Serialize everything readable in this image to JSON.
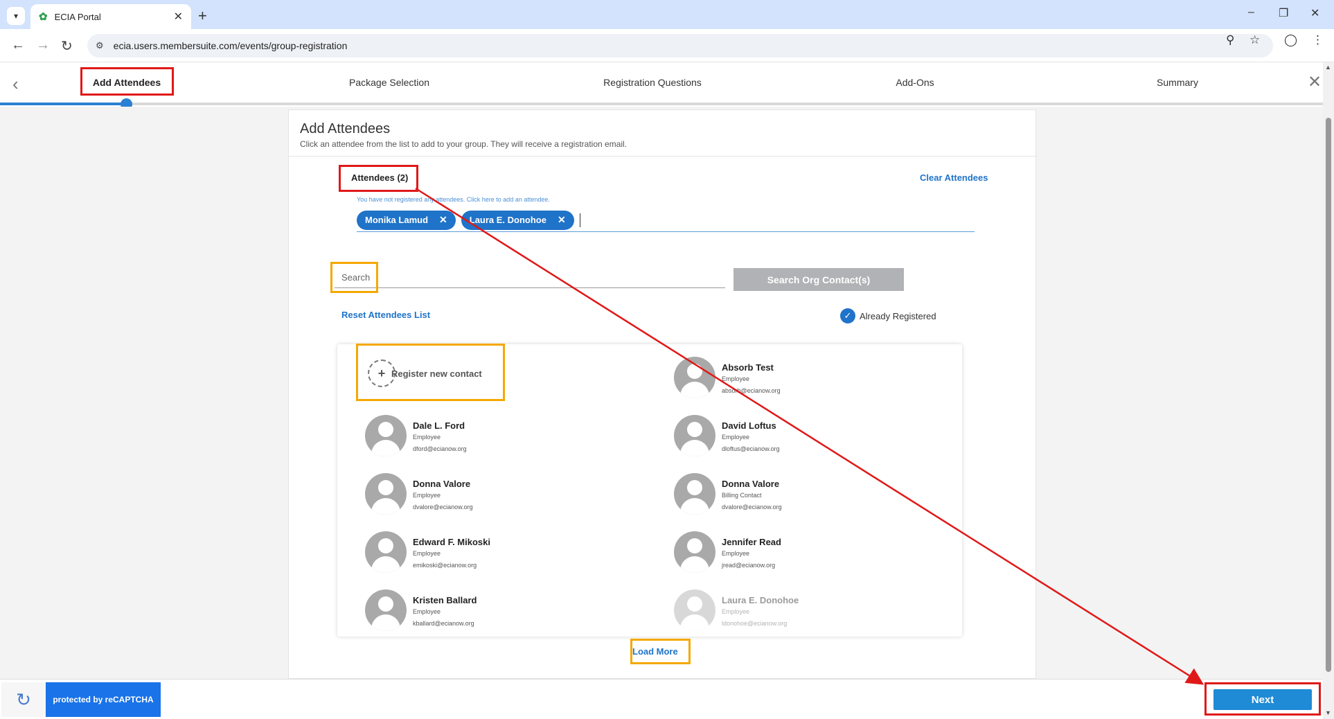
{
  "browser": {
    "tab_title": "ECIA Portal",
    "url": "ecia.users.membersuite.com/events/group-registration"
  },
  "wizard": {
    "steps": [
      "Add Attendees",
      "Package Selection",
      "Registration Questions",
      "Add-Ons",
      "Summary"
    ],
    "progress_fraction": 0.095
  },
  "page": {
    "title": "Add Attendees",
    "subtitle": "Click an attendee from the list to add to your group. They will receive a registration email.",
    "attendees_label": "Attendees (2)",
    "clear_link": "Clear Attendees",
    "hint": "You have not registered any attendees. Click here to add an attendee.",
    "selected": [
      "Monika Lamud",
      "Laura E. Donohoe"
    ],
    "search_placeholder": "Search",
    "search_button": "Search Org Contact(s)",
    "reset_link": "Reset Attendees List",
    "already_registered": "Already Registered",
    "register_new": "Register new contact",
    "contacts": [
      {
        "name": "Absorb Test",
        "role": "Employee",
        "email": "absorb@ecianow.org"
      },
      {
        "name": "Dale L. Ford",
        "role": "Employee",
        "email": "dford@ecianow.org"
      },
      {
        "name": "David Loftus",
        "role": "Employee",
        "email": "dloftus@ecianow.org"
      },
      {
        "name": "Donna Valore",
        "role": "Employee",
        "email": "dvalore@ecianow.org"
      },
      {
        "name": "Donna Valore",
        "role": "Billing Contact",
        "email": "dvalore@ecianow.org"
      },
      {
        "name": "Edward F. Mikoski",
        "role": "Employee",
        "email": "emikoski@ecianow.org"
      },
      {
        "name": "Jennifer Read",
        "role": "Employee",
        "email": "jread@ecianow.org"
      },
      {
        "name": "Kristen Ballard",
        "role": "Employee",
        "email": "kballard@ecianow.org"
      },
      {
        "name": "Laura E. Donohoe",
        "role": "Employee",
        "email": "ldonohoe@ecianow.org"
      }
    ],
    "load_more": "Load More"
  },
  "footer": {
    "recaptcha": "protected by reCAPTCHA",
    "next_button": "Next"
  },
  "colors": {
    "accent": "#1f73c8",
    "highlight_red": "#e01818",
    "highlight_orange": "#f5a800"
  }
}
